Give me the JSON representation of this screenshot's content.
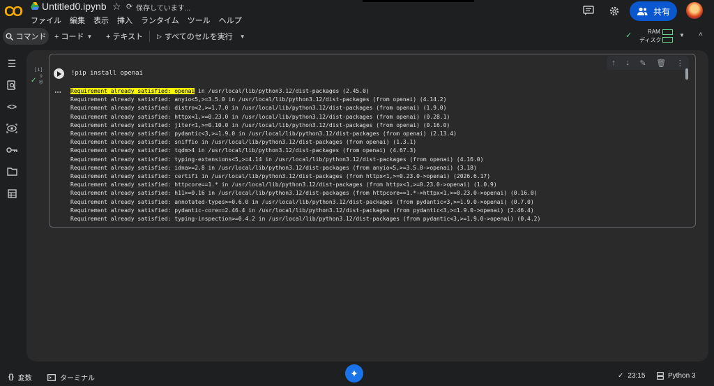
{
  "header": {
    "title": "Untitled0.ipynb",
    "saving_status": "保存しています...",
    "menu": [
      "ファイル",
      "編集",
      "表示",
      "挿入",
      "ランタイム",
      "ツール",
      "ヘルプ"
    ],
    "share_label": "共有",
    "logo_text": "CO"
  },
  "toolbar": {
    "command_label": "コマンド",
    "code_label": "+ コード",
    "text_label": "+ テキスト",
    "run_all_label": "すべてのセルを実行",
    "ram_label": "RAM",
    "disk_label": "ディスク"
  },
  "cell": {
    "exec_count": "[1]",
    "exec_time": "9\n秒",
    "code": "!pip install openai",
    "output_first_highlight": "Requirement already satisfied: openai",
    "output_first_rest": " in /usr/local/lib/python3.12/dist-packages (2.45.0)",
    "output_lines": [
      "Requirement already satisfied: anyio<5,>=3.5.0 in /usr/local/lib/python3.12/dist-packages (from openai) (4.14.2)",
      "Requirement already satisfied: distro<2,>=1.7.0 in /usr/local/lib/python3.12/dist-packages (from openai) (1.9.0)",
      "Requirement already satisfied: httpx<1,>=0.23.0 in /usr/local/lib/python3.12/dist-packages (from openai) (0.28.1)",
      "Requirement already satisfied: jiter<1,>=0.10.0 in /usr/local/lib/python3.12/dist-packages (from openai) (0.16.0)",
      "Requirement already satisfied: pydantic<3,>=1.9.0 in /usr/local/lib/python3.12/dist-packages (from openai) (2.13.4)",
      "Requirement already satisfied: sniffio in /usr/local/lib/python3.12/dist-packages (from openai) (1.3.1)",
      "Requirement already satisfied: tqdm>4 in /usr/local/lib/python3.12/dist-packages (from openai) (4.67.3)",
      "Requirement already satisfied: typing-extensions<5,>=4.14 in /usr/local/lib/python3.12/dist-packages (from openai) (4.16.0)",
      "Requirement already satisfied: idna>=2.8 in /usr/local/lib/python3.12/dist-packages (from anyio<5,>=3.5.0->openai) (3.18)",
      "Requirement already satisfied: certifi in /usr/local/lib/python3.12/dist-packages (from httpx<1,>=0.23.0->openai) (2026.6.17)",
      "Requirement already satisfied: httpcore==1.* in /usr/local/lib/python3.12/dist-packages (from httpx<1,>=0.23.0->openai) (1.0.9)",
      "Requirement already satisfied: h11>=0.16 in /usr/local/lib/python3.12/dist-packages (from httpcore==1.*->httpx<1,>=0.23.0->openai) (0.16.0)",
      "Requirement already satisfied: annotated-types>=0.6.0 in /usr/local/lib/python3.12/dist-packages (from pydantic<3,>=1.9.0->openai) (0.7.0)",
      "Requirement already satisfied: pydantic-core==2.46.4 in /usr/local/lib/python3.12/dist-packages (from pydantic<3,>=1.9.0->openai) (2.46.4)",
      "Requirement already satisfied: typing-inspection>=0.4.2 in /usr/local/lib/python3.12/dist-packages (from pydantic<3,>=1.9.0->openai) (0.4.2)"
    ]
  },
  "bottom": {
    "variables_label": "変数",
    "terminal_label": "ターミナル",
    "time": "23:15",
    "kernel": "Python 3"
  },
  "colors": {
    "accent": "#0b57d0",
    "highlight": "#f9f400",
    "logo": "#f9ab00",
    "success": "#6dd58c"
  }
}
